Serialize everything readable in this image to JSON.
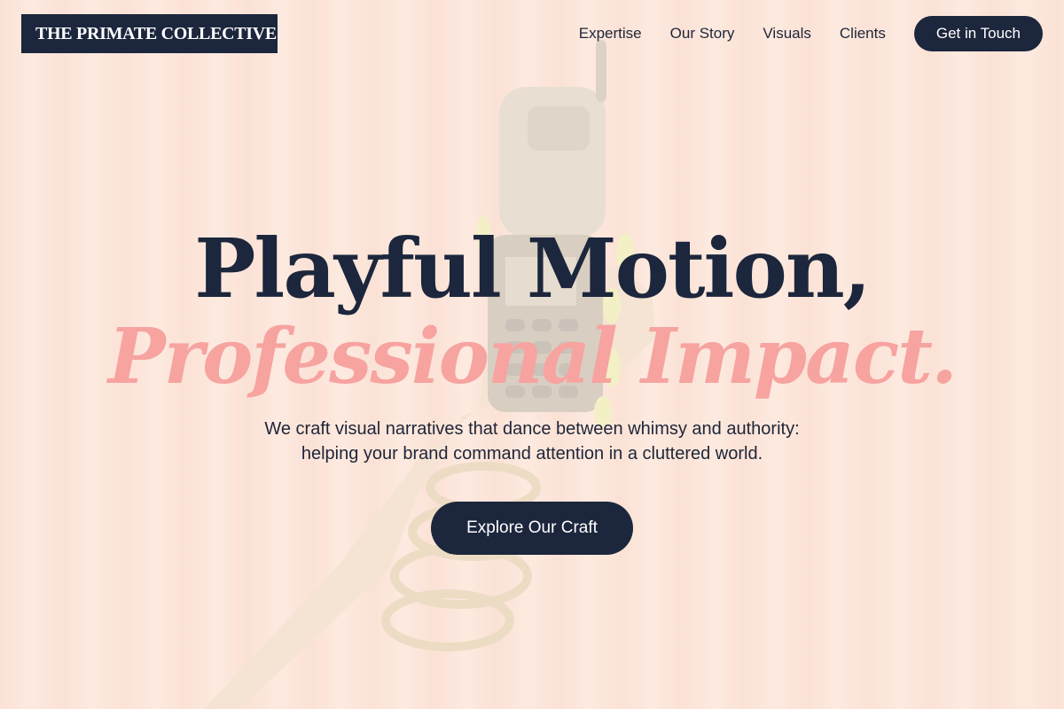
{
  "brand": {
    "name": "THE PRIMATE COLLECTIVE"
  },
  "nav": {
    "items": [
      {
        "label": "Expertise"
      },
      {
        "label": "Our Story"
      },
      {
        "label": "Visuals"
      },
      {
        "label": "Clients"
      }
    ],
    "cta_label": "Get in Touch"
  },
  "hero": {
    "headline": "Playful Motion,",
    "headline_accent": "Professional Impact.",
    "subtext_line1": "We craft visual narratives that dance between whimsy and authority:",
    "subtext_line2": "helping your brand command attention in a cluttered world.",
    "cta_label": "Explore Our Craft",
    "background_image": "hand-holding-flip-phone-photo"
  },
  "colors": {
    "navy": "#1c263c",
    "accent_pink": "#f7a3a0",
    "background_peach": "#f9dccf"
  }
}
